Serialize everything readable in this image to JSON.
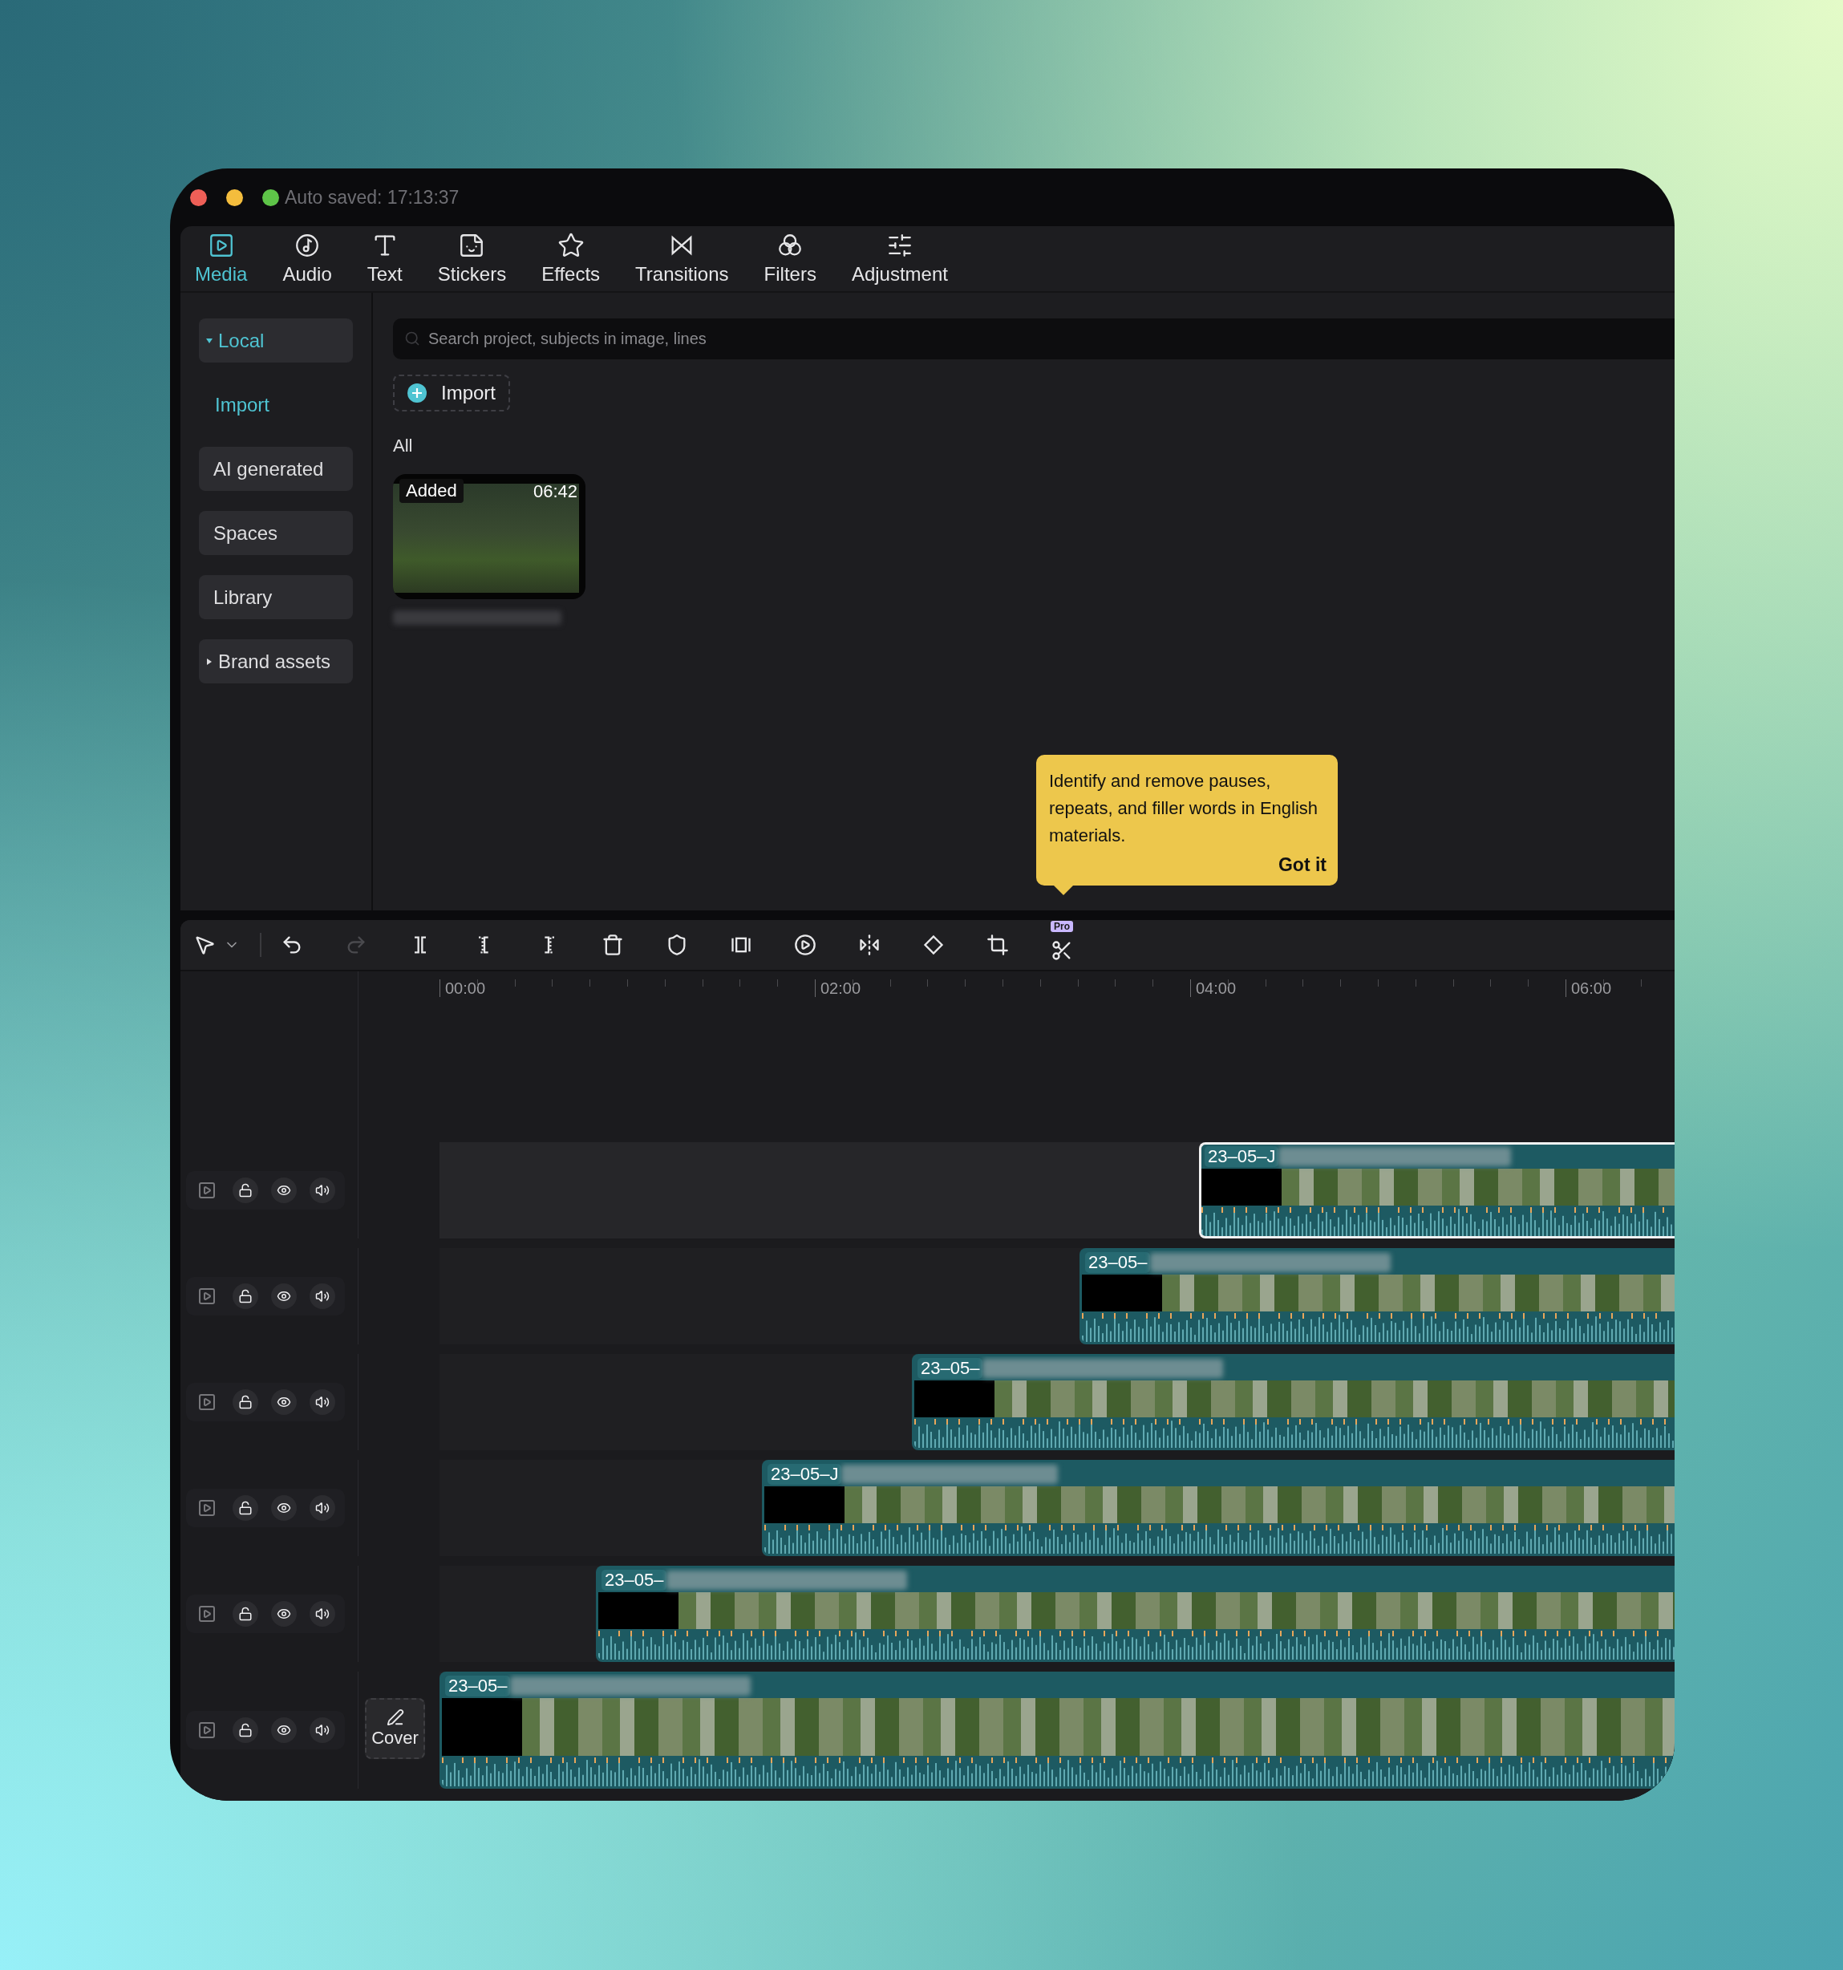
{
  "window": {
    "status": "Auto saved: 17:13:37"
  },
  "tabs": [
    {
      "label": "Media",
      "selected": true
    },
    {
      "label": "Audio",
      "selected": false
    },
    {
      "label": "Text",
      "selected": false
    },
    {
      "label": "Stickers",
      "selected": false
    },
    {
      "label": "Effects",
      "selected": false
    },
    {
      "label": "Transitions",
      "selected": false
    },
    {
      "label": "Filters",
      "selected": false
    },
    {
      "label": "Adjustment",
      "selected": false
    }
  ],
  "sidebar": {
    "items": [
      {
        "label": "Local",
        "kind": "group",
        "expanded": true,
        "selected": true,
        "children": [
          {
            "label": "Import",
            "selected": true
          }
        ]
      },
      {
        "label": "AI generated",
        "kind": "item",
        "selected": false
      },
      {
        "label": "Spaces",
        "kind": "item",
        "selected": false
      },
      {
        "label": "Library",
        "kind": "item",
        "selected": false
      },
      {
        "label": "Brand assets",
        "kind": "group",
        "expanded": false,
        "selected": false
      }
    ]
  },
  "media": {
    "search": {
      "placeholder": "Search project, subjects in image, lines"
    },
    "import_button": "Import",
    "filter_label": "All",
    "items": [
      {
        "badge": "Added",
        "duration": "06:42"
      }
    ]
  },
  "tooltip": {
    "text": "Identify and remove pauses, repeats, and filler words in English materials.",
    "button": "Got it"
  },
  "timeline": {
    "toolbar": {
      "undo_disabled": false,
      "redo_disabled": true,
      "pro_badge": "Pro"
    },
    "ruler": [
      "00:00",
      "02:00",
      "04:00",
      "06:00"
    ],
    "cover_button": "Cover",
    "tracks": [
      {
        "clip": {
          "label": "23–05–J",
          "selected": true
        }
      },
      {
        "clip": {
          "label": "23–05–",
          "selected": false
        }
      },
      {
        "clip": {
          "label": "23–05–",
          "selected": false
        }
      },
      {
        "clip": {
          "label": "23–05–J",
          "selected": false
        }
      },
      {
        "clip": {
          "label": "23–05–",
          "selected": false
        }
      },
      {
        "clip": {
          "label": "23–05–",
          "selected": false
        }
      }
    ]
  }
}
